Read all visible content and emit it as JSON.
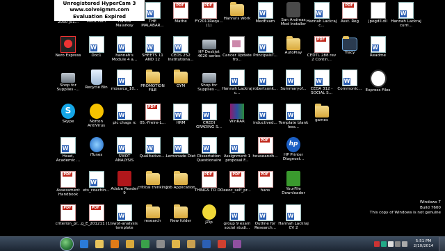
{
  "watermark": {
    "line1": "Unregistered HyperCam 3",
    "line2": "www.solveigmm.com",
    "line3": "Evaluation Expired"
  },
  "desktop_icons": [
    {
      "label": "HP Deskjet 2050 J51...",
      "type": "printer",
      "col": 0,
      "row": 0
    },
    {
      "label": "MedExam",
      "type": "word",
      "col": 1,
      "row": 0
    },
    {
      "label": "Hanna Malarkey",
      "type": "word",
      "col": 2,
      "row": 0
    },
    {
      "label": "THE MALABAR...",
      "type": "word",
      "col": 3,
      "row": 0
    },
    {
      "label": "Mathe",
      "type": "pdf",
      "col": 4,
      "row": 0
    },
    {
      "label": "FY2011Requ... (1)",
      "type": "pdf",
      "col": 5,
      "row": 0
    },
    {
      "label": "Hanna's Work",
      "type": "folder",
      "col": 6,
      "row": 0
    },
    {
      "label": "MedExam",
      "type": "word",
      "col": 7,
      "row": 0
    },
    {
      "label": "San Andreas Mod Installer",
      "type": "cam",
      "col": 8,
      "row": 0
    },
    {
      "label": "Hannah Lackraj c...",
      "type": "word",
      "col": 9,
      "row": 0
    },
    {
      "label": "Asst. Reg",
      "type": "pdf",
      "col": 10,
      "row": 0
    },
    {
      "label": "jpegdll.dll",
      "type": "jpeg",
      "col": 11,
      "row": 0
    },
    {
      "label": "Hannah Lackraj curri...",
      "type": "word",
      "col": 12,
      "row": 0
    },
    {
      "label": "Nero Express",
      "type": "nero",
      "col": 0,
      "row": 1
    },
    {
      "label": "Doc1",
      "type": "word",
      "col": 1,
      "row": 1
    },
    {
      "label": "hannah's Module 4 a...",
      "type": "word",
      "col": 2,
      "row": 1
    },
    {
      "label": "SHEETS 11 AND 12",
      "type": "word",
      "col": 3,
      "row": 1
    },
    {
      "label": "CEDS 252 Institutiona...",
      "type": "word",
      "col": 4,
      "row": 1
    },
    {
      "label": "HP Deskjet 4620 series",
      "type": "printer",
      "col": 5,
      "row": 1
    },
    {
      "label": "Cancer Update fro...",
      "type": "cancer",
      "col": 6,
      "row": 1
    },
    {
      "label": "PrincipalsT...",
      "type": "word",
      "col": 7,
      "row": 1
    },
    {
      "label": "AutoPlay",
      "type": "folder",
      "col": 8,
      "row": 1
    },
    {
      "label": "CEDTL 288 rev 2 Contin...",
      "type": "pdf",
      "col": 9,
      "row": 1
    },
    {
      "label": "Tracy",
      "type": "folder",
      "col": 10,
      "row": 1,
      "selected": true
    },
    {
      "label": "Readme",
      "type": "word",
      "col": 11,
      "row": 1
    },
    {
      "label": "Shop for Supplies -...",
      "type": "printer",
      "col": 0,
      "row": 2
    },
    {
      "label": "Recycle Bin",
      "type": "recycle",
      "col": 1,
      "row": 2
    },
    {
      "label": "mosaica_10...",
      "type": "word",
      "col": 2,
      "row": 2
    },
    {
      "label": "PROMOTION FILE",
      "type": "folder",
      "col": 3,
      "row": 2
    },
    {
      "label": "GYM",
      "type": "folder",
      "col": 4,
      "row": 2
    },
    {
      "label": "Shop for Supplies -...",
      "type": "printer",
      "col": 5,
      "row": 2
    },
    {
      "label": "Hannah Lackraj c...",
      "type": "word",
      "col": 6,
      "row": 2
    },
    {
      "label": "robertsonk...",
      "type": "word",
      "col": 7,
      "row": 2
    },
    {
      "label": "Summaryof...",
      "type": "word",
      "col": 8,
      "row": 2
    },
    {
      "label": "CEDA 312 - SOCIAL S...",
      "type": "word",
      "col": 9,
      "row": 2
    },
    {
      "label": "Commonic...",
      "type": "word",
      "col": 10,
      "row": 2
    },
    {
      "label": "Express Files",
      "type": "express",
      "col": 11,
      "row": 2
    },
    {
      "label": "Skype",
      "type": "skype",
      "col": 0,
      "row": 3
    },
    {
      "label": "Norton AntiVirus",
      "type": "norton",
      "col": 1,
      "row": 3
    },
    {
      "label": "pic chags rc",
      "type": "word",
      "col": 2,
      "row": 3
    },
    {
      "label": "05.-Freire-L...",
      "type": "pdf",
      "col": 3,
      "row": 3
    },
    {
      "label": "HRM",
      "type": "word",
      "col": 4,
      "row": 3
    },
    {
      "label": "CREDI GRADING S...",
      "type": "word",
      "col": 5,
      "row": 3
    },
    {
      "label": "WinRAR",
      "type": "winrar",
      "col": 6,
      "row": 3
    },
    {
      "label": "inductived...",
      "type": "word",
      "col": 7,
      "row": 3
    },
    {
      "label": "Template blank less...",
      "type": "word",
      "col": 8,
      "row": 3
    },
    {
      "label": "games",
      "type": "folder",
      "col": 9,
      "row": 3
    },
    {
      "label": "Head, Academic ...",
      "type": "word",
      "col": 0,
      "row": 4
    },
    {
      "label": "iTunes",
      "type": "itunes",
      "col": 1,
      "row": 4
    },
    {
      "label": "SWOT ANALYSIS",
      "type": "word",
      "col": 2,
      "row": 4
    },
    {
      "label": "Qualitative....",
      "type": "word",
      "col": 3,
      "row": 4
    },
    {
      "label": "Lemonade Diet",
      "type": "word",
      "col": 4,
      "row": 4
    },
    {
      "label": "Dissertation Questionaire",
      "type": "word",
      "col": 5,
      "row": 4
    },
    {
      "label": "Assignment 1 proposal F...",
      "type": "word",
      "col": 6,
      "row": 4
    },
    {
      "label": "houseandh...",
      "type": "pdf",
      "col": 7,
      "row": 4
    },
    {
      "label": "HP Printer Diagnost...",
      "type": "hp",
      "col": 8,
      "row": 4
    },
    {
      "label": "Assessment Handbook",
      "type": "pdf",
      "col": 0,
      "row": 5
    },
    {
      "label": "ets_coachin...",
      "type": "word",
      "col": 1,
      "row": 5
    },
    {
      "label": "Adobe Reader 9",
      "type": "adobe",
      "col": 2,
      "row": 5
    },
    {
      "label": "critical thinking",
      "type": "folder",
      "col": 3,
      "row": 5
    },
    {
      "label": "Job Application",
      "type": "folder",
      "col": 4,
      "row": 5
    },
    {
      "label": "THINGS TO DO",
      "type": "pdf",
      "col": 5,
      "row": 5
    },
    {
      "label": "eeoc_self_pr...",
      "type": "pdf",
      "col": 6,
      "row": 5
    },
    {
      "label": "hans",
      "type": "pdf",
      "col": 7,
      "row": 5
    },
    {
      "label": "YourFile Downloader",
      "type": "youfile",
      "col": 8,
      "row": 5
    },
    {
      "label": "criterion_pr...",
      "type": "pdf",
      "col": 0,
      "row": 6
    },
    {
      "label": "g_E_201211 (1)",
      "type": "pdf",
      "col": 1,
      "row": 6
    },
    {
      "label": "swot-analysis template",
      "type": "word",
      "col": 2,
      "row": 6
    },
    {
      "label": "research",
      "type": "folder",
      "col": 3,
      "row": 6
    },
    {
      "label": "New folder",
      "type": "folder",
      "col": 4,
      "row": 6
    },
    {
      "label": "jZip",
      "type": "jzip",
      "col": 5,
      "row": 6
    },
    {
      "label": "group 9 exam social studi...",
      "type": "word",
      "col": 6,
      "row": 6
    },
    {
      "label": "Outline for Research...",
      "type": "word",
      "col": 7,
      "row": 6
    },
    {
      "label": "Hannah Lackraj CV 2",
      "type": "word",
      "col": 8,
      "row": 6
    }
  ],
  "genuine_notice": {
    "line1": "Windows 7",
    "line2": "Build 7600",
    "line3": "This copy of Windows is not genuine"
  },
  "taskbar": {
    "apps": [
      {
        "name": "ie-icon",
        "color": "#2b7bd8"
      },
      {
        "name": "explorer-icon",
        "color": "#e8c45c"
      },
      {
        "name": "media-player-icon",
        "color": "#e07b18"
      },
      {
        "name": "folder-icon",
        "color": "#d9a93c"
      },
      {
        "name": "chrome-icon",
        "color": "#3aa04a"
      },
      {
        "name": "app-icon",
        "color": "#8c8c8c"
      },
      {
        "name": "folder-icon-2",
        "color": "#e0b64a"
      },
      {
        "name": "folder-icon-3",
        "color": "#c9a050"
      },
      {
        "name": "word-icon",
        "color": "#2b5fb3"
      },
      {
        "name": "app-icon-2",
        "color": "#d04030"
      },
      {
        "name": "app-icon-3",
        "color": "#9050a0"
      }
    ],
    "clock_time": "5:51 PM",
    "clock_date": "2/10/2014"
  }
}
